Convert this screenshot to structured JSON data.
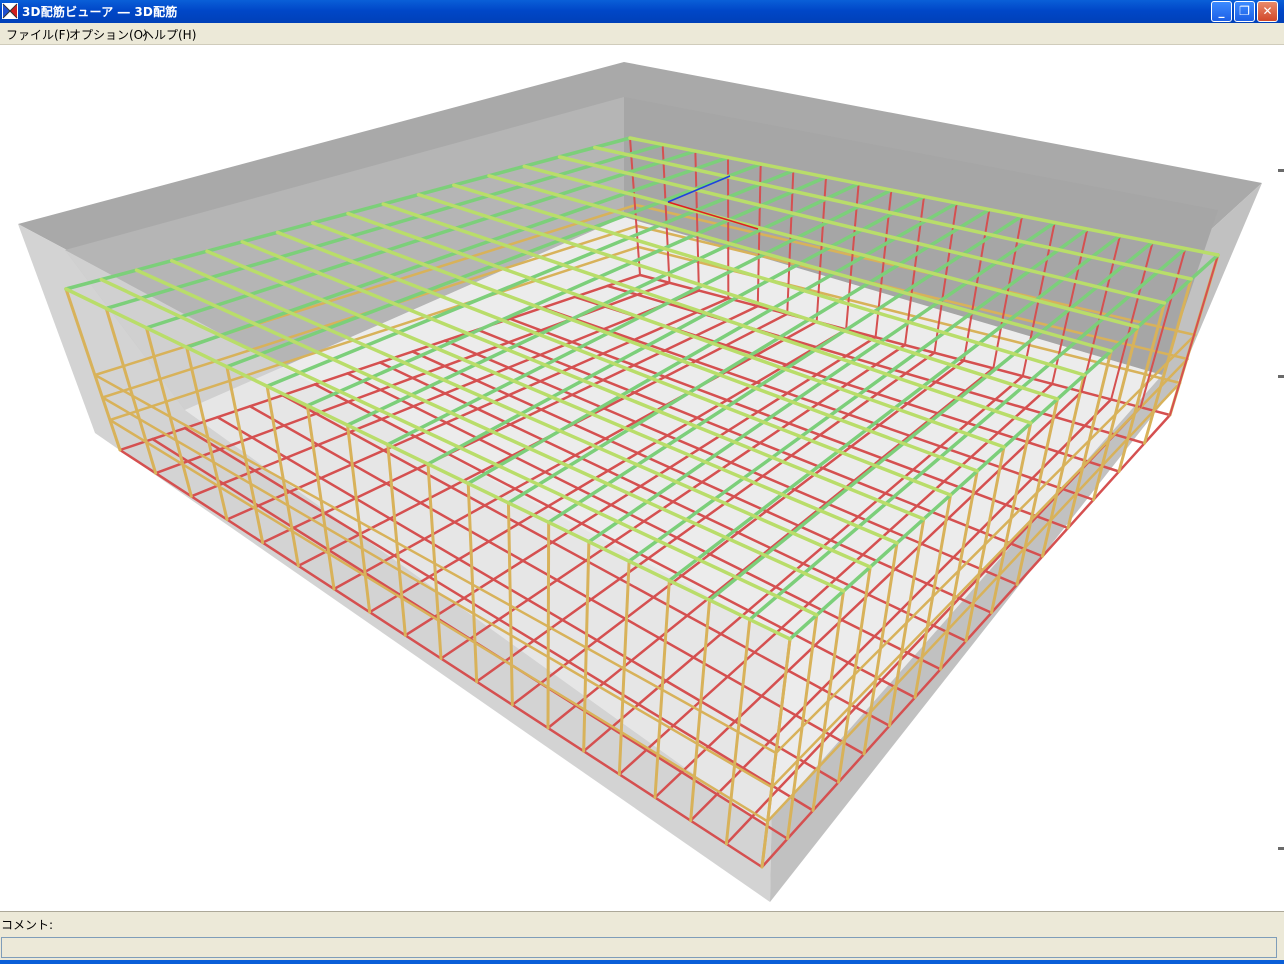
{
  "window": {
    "title": "3D配筋ビューア ― 3D配筋"
  },
  "menu": {
    "items": [
      "ファイル(F)",
      "オプション(O)",
      "ヘルプ(H)"
    ]
  },
  "buttons": {
    "minimize": "_",
    "maximize": "❐",
    "close": "✕"
  },
  "comment": {
    "label": "コメント:",
    "value": ""
  },
  "colors": {
    "titlebar": "#0a5fd8",
    "viewport_bg": "#ffffff",
    "concrete_top": "#a9a9a9",
    "concrete_front": "#cfcfcf",
    "concrete_side": "#bdbdbd",
    "floor": "#ececec",
    "rebar_top": "#7ccf7a",
    "rebar_top_cross": "#b9dd6a",
    "rebar_mid": "#d8b25a",
    "rebar_bottom": "#d55050",
    "axis_x": "#e02020",
    "axis_y": "#2040e0"
  }
}
